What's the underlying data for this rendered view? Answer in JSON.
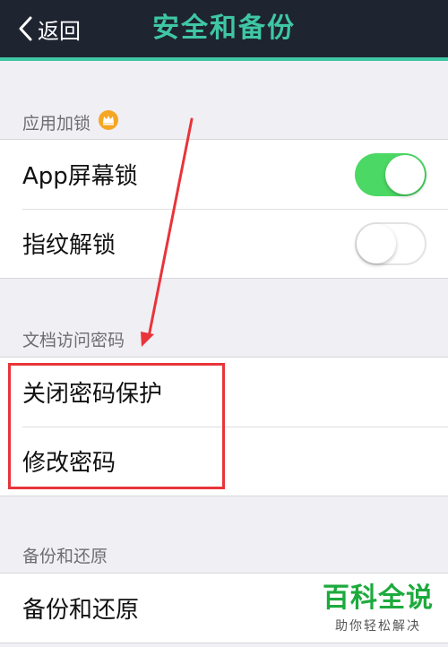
{
  "navbar": {
    "back_label": "返回",
    "title": "安全和备份",
    "accent_color": "#3fc7a4",
    "background_color": "#1e2430"
  },
  "sections": {
    "app_lock": {
      "header": "应用加锁",
      "header_icon": "crown-icon",
      "rows": [
        {
          "label": "App屏幕锁",
          "toggle_on": true
        },
        {
          "label": "指纹解锁",
          "toggle_on": false
        }
      ]
    },
    "doc_password": {
      "header": "文档访问密码",
      "rows": [
        {
          "label": "关闭密码保护"
        },
        {
          "label": "修改密码"
        }
      ]
    },
    "backup": {
      "header": "备份和还原",
      "rows": [
        {
          "label": "备份和还原"
        }
      ]
    }
  },
  "annotation": {
    "highlight_color": "#e8343a",
    "arrow_color": "#e8343a"
  },
  "watermark": {
    "brand": "百科全说",
    "tagline": "助你轻松解决",
    "brand_color": "#1daa3d"
  },
  "colors": {
    "toggle_on": "#4cd864",
    "background": "#efeff4"
  }
}
